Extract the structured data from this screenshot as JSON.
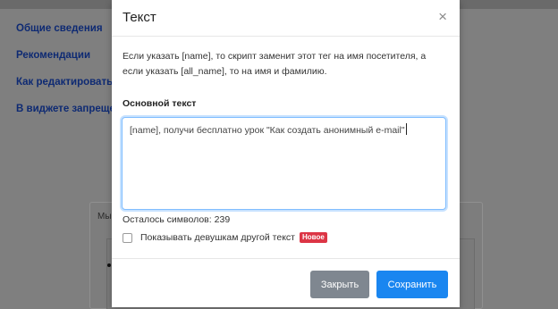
{
  "background": {
    "sidebar_links": [
      "Общие сведения",
      "Рекомендации",
      "Как редактировать",
      "В виджете запрещено"
    ],
    "card_label": "Мы"
  },
  "modal": {
    "title": "Текст",
    "close_icon": "×",
    "description": "Если указать [name], то скрипт заменит этот тег на имя посетителя, а если указать [all_name], то на имя и фамилию.",
    "field_label": "Основной текст",
    "textarea_value": "[name], получи бесплатно урок \"Как создать анонимный e-mail\"",
    "chars_left_label": "Осталось символов:",
    "chars_left_value": "239",
    "checkbox_label": "Показывать девушкам другой текст",
    "checkbox_checked": false,
    "new_badge": "Новое",
    "close_button": "Закрыть",
    "save_button": "Сохранить"
  },
  "colors": {
    "primary": "#1a86f0",
    "secondary": "#7f8790",
    "badge": "#dc3545",
    "link": "#0e2a73"
  }
}
